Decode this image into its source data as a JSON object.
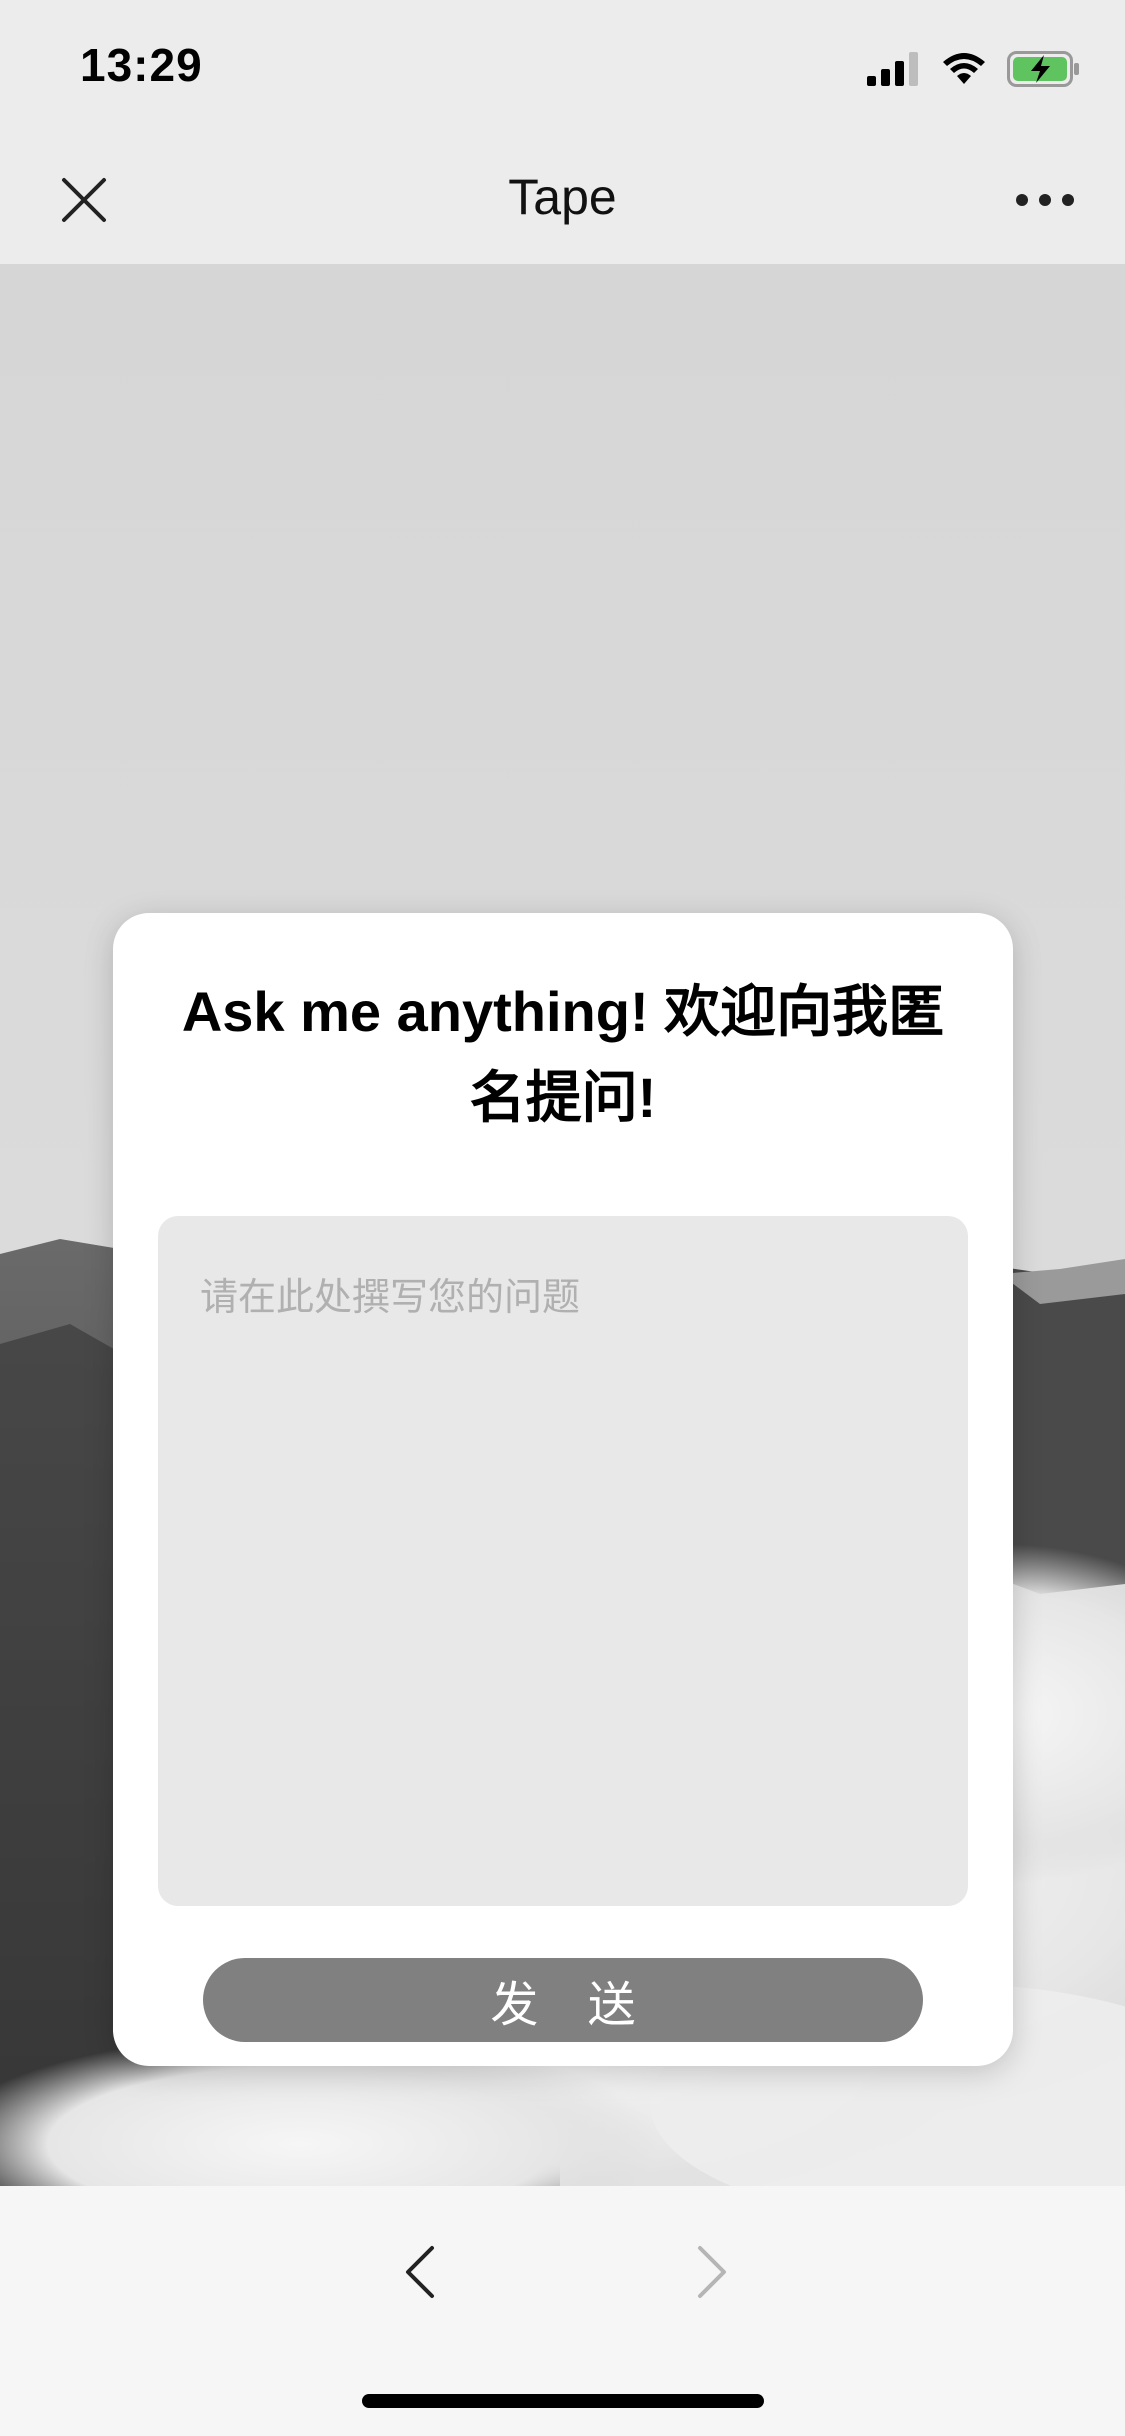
{
  "status_bar": {
    "time": "13:29",
    "icons": [
      "cellular-signal-icon",
      "wifi-icon",
      "battery-charging-icon"
    ],
    "battery_color": "#5fc35f"
  },
  "nav_bar": {
    "title": "Tape",
    "left_icon": "close-icon",
    "right_icon": "more-icon"
  },
  "card": {
    "title": "Ask me anything! 欢迎向我匿名提问!",
    "question_placeholder": "请在此处撰写您的问题",
    "question_value": "",
    "send_label": "发 送",
    "send_color": "#808080"
  },
  "bottom_bar": {
    "back_icon": "chevron-left-icon",
    "forward_icon": "chevron-right-icon",
    "forward_enabled": false
  }
}
